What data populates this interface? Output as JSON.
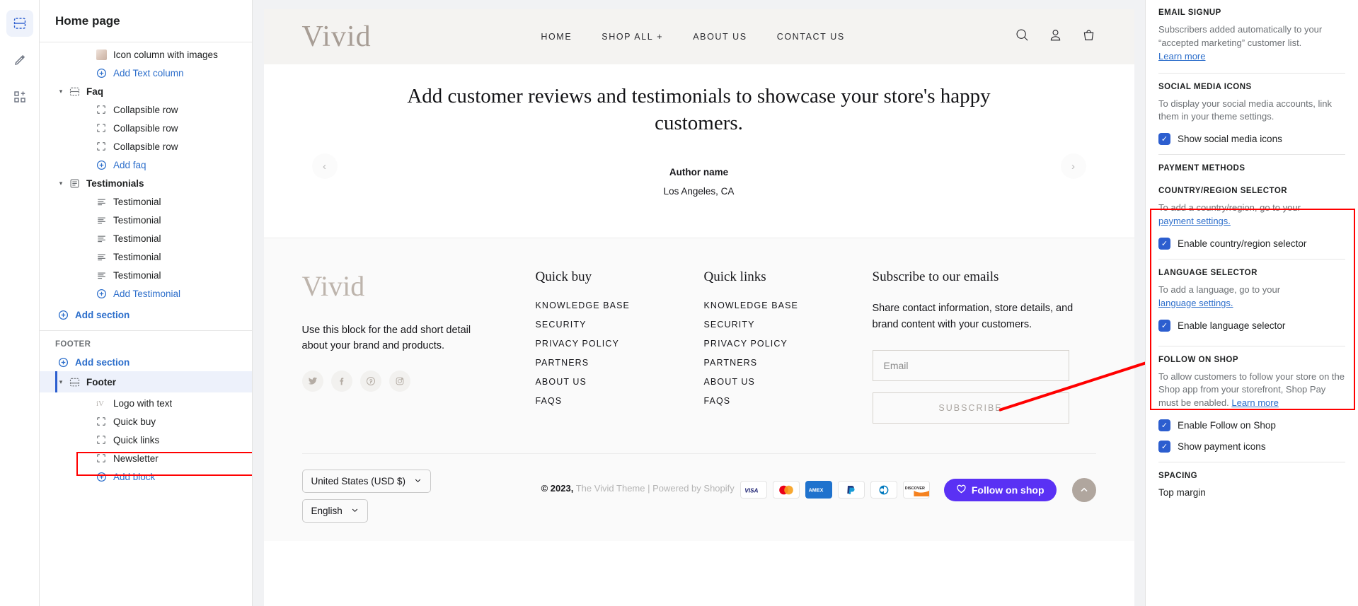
{
  "rail": {
    "items": [
      {
        "name": "sections-icon",
        "active": true
      },
      {
        "name": "theme-settings-icon",
        "active": false
      },
      {
        "name": "apps-icon",
        "active": false
      }
    ]
  },
  "sidebar": {
    "title": "Home page",
    "tree": [
      {
        "label": "Icon column with images",
        "kind": "block-image",
        "indent": 2
      },
      {
        "label": "Add Text column",
        "kind": "add-sub",
        "indent": 2
      },
      {
        "label": "Faq",
        "kind": "section",
        "indent": 1,
        "icon": "section-icon"
      },
      {
        "label": "Collapsible row",
        "kind": "block",
        "indent": 2,
        "icon": "block-icon"
      },
      {
        "label": "Collapsible row",
        "kind": "block",
        "indent": 2,
        "icon": "block-icon"
      },
      {
        "label": "Collapsible row",
        "kind": "block",
        "indent": 2,
        "icon": "block-icon"
      },
      {
        "label": "Add faq",
        "kind": "add-sub",
        "indent": 2
      },
      {
        "label": "Testimonials",
        "kind": "section",
        "indent": 1,
        "icon": "testimonials-icon"
      },
      {
        "label": "Testimonial",
        "kind": "block",
        "indent": 2,
        "icon": "text-lines-icon"
      },
      {
        "label": "Testimonial",
        "kind": "block",
        "indent": 2,
        "icon": "text-lines-icon"
      },
      {
        "label": "Testimonial",
        "kind": "block",
        "indent": 2,
        "icon": "text-lines-icon"
      },
      {
        "label": "Testimonial",
        "kind": "block",
        "indent": 2,
        "icon": "text-lines-icon"
      },
      {
        "label": "Testimonial",
        "kind": "block",
        "indent": 2,
        "icon": "text-lines-icon"
      },
      {
        "label": "Add Testimonial",
        "kind": "add-sub",
        "indent": 2
      },
      {
        "label": "Add section",
        "kind": "add",
        "indent": 1
      }
    ],
    "footer_group": {
      "group_title": "FOOTER",
      "add_section": "Add section",
      "selected_item": {
        "label": "Footer",
        "icon": "section-icon"
      },
      "blocks": [
        {
          "label": "Logo with text",
          "icon": "logo-text-icon"
        },
        {
          "label": "Quick buy",
          "icon": "block-icon"
        },
        {
          "label": "Quick links",
          "icon": "block-icon"
        },
        {
          "label": "Newsletter",
          "icon": "block-icon"
        }
      ],
      "add_block": "Add block"
    }
  },
  "preview": {
    "store": {
      "logo": "Vivid",
      "nav": [
        "HOME",
        "SHOP ALL",
        "ABOUT US",
        "CONTACT US"
      ],
      "shop_all_has_plus": true,
      "icons": [
        "search-icon",
        "account-icon",
        "cart-icon"
      ]
    },
    "testimonial": {
      "quote": "Add customer reviews and testimonials to showcase your store's happy customers.",
      "author": "Author name",
      "location": "Los Angeles, CA",
      "prev": "‹",
      "next": "›"
    },
    "footer": {
      "logo": "Vivid",
      "blurb": "Use this block for the add short detail about your brand and products.",
      "socials": [
        "twitter-icon",
        "facebook-icon",
        "pinterest-icon",
        "instagram-icon"
      ],
      "columns": [
        {
          "title": "Quick buy",
          "links": [
            "KNOWLEDGE BASE",
            "SECURITY",
            "PRIVACY POLICY",
            "PARTNERS",
            "ABOUT US",
            "FAQS"
          ]
        },
        {
          "title": "Quick links",
          "links": [
            "KNOWLEDGE BASE",
            "SECURITY",
            "PRIVACY POLICY",
            "PARTNERS",
            "ABOUT US",
            "FAQS"
          ]
        }
      ],
      "subscribe": {
        "title": "Subscribe to our emails",
        "text": "Share contact information, store details, and brand content with your customers.",
        "email_placeholder": "Email",
        "button": "SUBSCRIBE"
      },
      "country_selector": "United States (USD $)",
      "language_selector": "English",
      "copyright_prefix": "© 2023,",
      "copyright_theme": "The Vivid Theme",
      "copyright_sep": "|",
      "copyright_powered": "Powered by Shopify",
      "payment_icons": [
        "VISA",
        "mastercard",
        "AMEX",
        "PayPal",
        "Diners Club",
        "DISCOVER"
      ],
      "follow_on_shop": "Follow on shop",
      "back_to_top": "back-to-top-icon"
    }
  },
  "panel": {
    "blocks": [
      {
        "title": "EMAIL SIGNUP",
        "desc": "Subscribers added automatically to your “accepted marketing” customer list.",
        "link": "Learn more"
      },
      {
        "title": "SOCIAL MEDIA ICONS",
        "desc": "To display your social media accounts, link them in your theme settings.",
        "checkbox": "Show social media icons",
        "checked": true
      },
      {
        "title": "PAYMENT METHODS"
      },
      {
        "title": "COUNTRY/REGION SELECTOR",
        "desc": "To add a country/region, go to your",
        "link": "payment settings.",
        "checkbox": "Enable country/region selector",
        "checked": true
      },
      {
        "title": "LANGUAGE SELECTOR",
        "desc": "To add a language, go to your",
        "link": "language settings.",
        "checkbox": "Enable language selector",
        "checked": true
      },
      {
        "title": "FOLLOW ON SHOP",
        "desc": "To allow customers to follow your store on the Shop app from your storefront, Shop Pay must be enabled.",
        "link": "Learn more",
        "checkbox": "Enable Follow on Shop",
        "checked": true,
        "checkbox2": "Show payment icons",
        "checked2": true
      },
      {
        "title": "SPACING",
        "sub": "Top margin"
      }
    ]
  },
  "annotations": {
    "highlight_color": "#ff0000",
    "arrow": "red-arrow-annotation"
  }
}
